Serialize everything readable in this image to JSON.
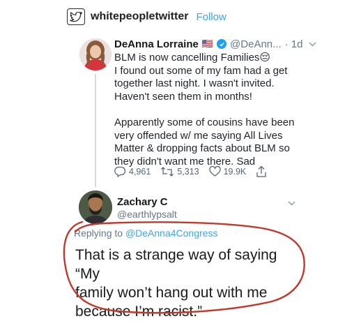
{
  "header": {
    "account_name": "whitepeopletwitter",
    "follow_label": "Follow"
  },
  "tweet": {
    "author_name": "DeAnna Lorraine",
    "flag_emoji": "🇺🇸",
    "handle": "@DeAnn...",
    "time": "· 1d",
    "lines": [
      "BLM is now cancelling Families😔",
      "I found out some of my fam had a get",
      "together last night. I wasn't invited.",
      "Haven't seen them in months!",
      "",
      "Apparently some of cousins have been",
      "very offended w/ me saying All Lives",
      "Matter & dropping facts about BLM so",
      "they didn't want me there. Sad"
    ],
    "reply_count": "4,961",
    "retweet_count": "5,313",
    "like_count": "19.9K"
  },
  "reply": {
    "author_name": "Zachary C",
    "handle": "@earthlypsalt",
    "replying_prefix": "Replying to ",
    "replying_to": "@DeAnna4Congress",
    "lines": [
      "That is a strange way of saying “My",
      "family won’t hang out with me",
      "because I’m racist.”"
    ]
  },
  "colors": {
    "link_blue": "#3fa3e6",
    "verified_blue": "#1da1f2",
    "annotation_red": "#c0392b"
  }
}
